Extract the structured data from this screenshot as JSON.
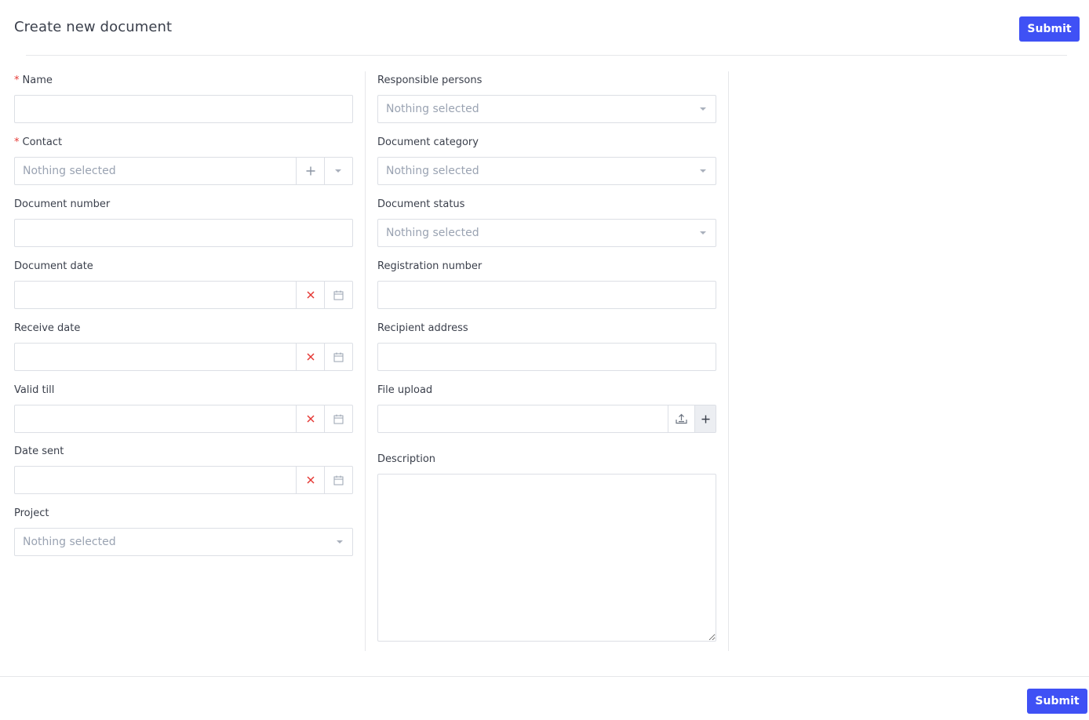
{
  "header": {
    "title": "Create new document",
    "submit_label": "Submit"
  },
  "footer": {
    "submit_label": "Submit"
  },
  "colors": {
    "primary": "#3f51f5",
    "required": "#e53935",
    "border": "#dcdfe5",
    "placeholder": "#9aa3b2",
    "clear_icon": "#e53935"
  },
  "left_column": {
    "name": {
      "label": "Name",
      "required_mark": "*",
      "value": ""
    },
    "contact": {
      "label": "Contact",
      "required_mark": "*",
      "placeholder": "Nothing selected",
      "add_icon": "plus-icon",
      "dropdown_icon": "chevron-down-icon"
    },
    "document_number": {
      "label": "Document number",
      "value": ""
    },
    "document_date": {
      "label": "Document date",
      "value": "",
      "clear_icon": "close-icon",
      "calendar_icon": "calendar-icon"
    },
    "receive_date": {
      "label": "Receive date",
      "value": "",
      "clear_icon": "close-icon",
      "calendar_icon": "calendar-icon"
    },
    "valid_till": {
      "label": "Valid till",
      "value": "",
      "clear_icon": "close-icon",
      "calendar_icon": "calendar-icon"
    },
    "date_sent": {
      "label": "Date sent",
      "value": "",
      "clear_icon": "close-icon",
      "calendar_icon": "calendar-icon"
    },
    "project": {
      "label": "Project",
      "placeholder": "Nothing selected"
    }
  },
  "right_column": {
    "responsible_persons": {
      "label": "Responsible persons",
      "placeholder": "Nothing selected"
    },
    "document_category": {
      "label": "Document category",
      "placeholder": "Nothing selected"
    },
    "document_status": {
      "label": "Document status",
      "placeholder": "Nothing selected"
    },
    "registration_number": {
      "label": "Registration number",
      "value": ""
    },
    "recipient_address": {
      "label": "Recipient address",
      "value": ""
    },
    "file_upload": {
      "label": "File upload",
      "value": "",
      "upload_icon": "upload-icon",
      "add_icon": "plus-icon"
    },
    "description": {
      "label": "Description",
      "value": ""
    }
  }
}
